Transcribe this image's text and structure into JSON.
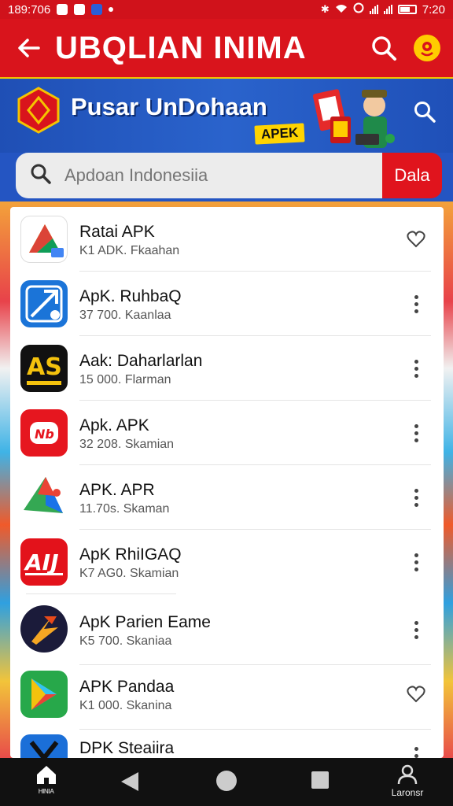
{
  "status_bar": {
    "time_left": "189:706",
    "time_right": "7:20"
  },
  "app_bar": {
    "title": "UBQLIAN INIMA"
  },
  "banner": {
    "title": "Pusar UnDohaan",
    "badge": "APEK"
  },
  "search": {
    "placeholder": "Apdoan Indonesiia",
    "button_label": "Dala"
  },
  "apps": [
    {
      "name": "Ratai APK",
      "sub": "K1 ADK. Fkaahan",
      "action": "favorite"
    },
    {
      "name": "ApK. RuhbaQ",
      "sub": "37 700. Kaanlaa",
      "action": "more"
    },
    {
      "name": "Aak: Daharlarlan",
      "sub": "15 000. Flarman",
      "action": "more"
    },
    {
      "name": "Apk. APK",
      "sub": "32 208. Skamian",
      "action": "more"
    },
    {
      "name": "APK. APR",
      "sub": "11.70s. Skaman",
      "action": "more"
    },
    {
      "name": "ApK RhiIGAQ",
      "sub": "K7 AG0. Skamian",
      "action": "more"
    },
    {
      "name": "ApK Parien Eame",
      "sub": "K5 700. Skaniaa",
      "action": "more"
    },
    {
      "name": "APK Pandaa",
      "sub": "K1 000. Skanina",
      "action": "favorite"
    },
    {
      "name": "DPK Steaiira",
      "sub": "",
      "action": "more"
    }
  ],
  "bottom_nav": {
    "home_label": "ᴴᴵᴺᴵᴬ",
    "profile_label": "Laronsr"
  },
  "colors": {
    "primary_red": "#d9141c",
    "banner_blue": "#2455c2",
    "badge_yellow": "#ffd400"
  },
  "icons": [
    "back-arrow-icon",
    "search-icon",
    "mascot-icon",
    "favorite-heart-icon",
    "more-vert-icon",
    "home-icon",
    "back-triangle-icon",
    "home-circle-icon",
    "recents-square-icon",
    "profile-icon"
  ]
}
